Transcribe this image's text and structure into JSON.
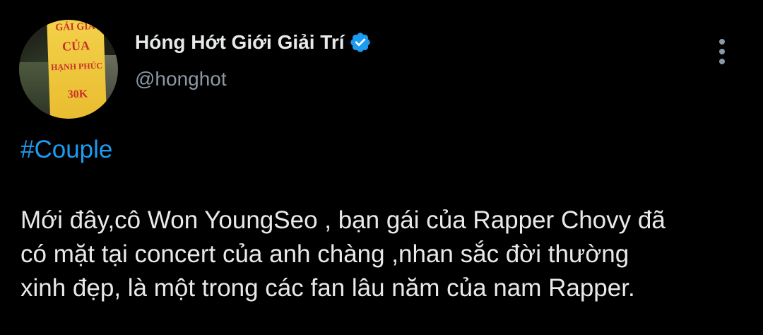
{
  "tweet": {
    "author": {
      "display_name": "Hóng Hớt Giới Giải Trí",
      "handle": "@honghot",
      "verified_icon": "verified-badge-icon",
      "avatar_sign_lines": [
        "GÁI GIA",
        "CỦA",
        "HẠNH PHÚC",
        "30K"
      ]
    },
    "more_icon": "more-vertical-icon",
    "hashtag": "#Couple",
    "body_lines": [
      "Mới đây,cô Won YoungSeo , bạn gái của Rapper Chovy đã",
      "có mặt tại concert của anh chàng ,nhan sắc đời thường",
      "xinh đẹp, là một trong các fan lâu năm của nam Rapper."
    ]
  },
  "colors": {
    "background": "#000000",
    "text_primary": "#e7e9ea",
    "text_secondary": "#8b98a5",
    "accent": "#1d9bf0"
  }
}
